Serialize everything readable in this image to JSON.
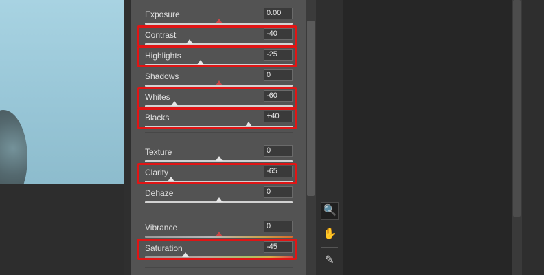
{
  "sliders": [
    {
      "id": "exposure",
      "label": "Exposure",
      "value": "0.00",
      "pos": 0.5,
      "neutral": true,
      "highlighted": false,
      "track": "plain"
    },
    {
      "id": "contrast",
      "label": "Contrast",
      "value": "-40",
      "pos": 0.3,
      "neutral": false,
      "highlighted": true,
      "track": "plain"
    },
    {
      "id": "highlights",
      "label": "Highlights",
      "value": "-25",
      "pos": 0.375,
      "neutral": false,
      "highlighted": true,
      "track": "plain"
    },
    {
      "id": "shadows",
      "label": "Shadows",
      "value": "0",
      "pos": 0.5,
      "neutral": true,
      "highlighted": false,
      "track": "plain"
    },
    {
      "id": "whites",
      "label": "Whites",
      "value": "-60",
      "pos": 0.2,
      "neutral": false,
      "highlighted": true,
      "track": "plain"
    },
    {
      "id": "blacks",
      "label": "Blacks",
      "value": "+40",
      "pos": 0.7,
      "neutral": false,
      "highlighted": true,
      "track": "plain"
    },
    {
      "id": "texture",
      "label": "Texture",
      "value": "0",
      "pos": 0.5,
      "neutral": false,
      "highlighted": false,
      "track": "plain"
    },
    {
      "id": "clarity",
      "label": "Clarity",
      "value": "-65",
      "pos": 0.175,
      "neutral": false,
      "highlighted": true,
      "track": "plain"
    },
    {
      "id": "dehaze",
      "label": "Dehaze",
      "value": "0",
      "pos": 0.5,
      "neutral": false,
      "highlighted": false,
      "track": "plain"
    },
    {
      "id": "vibrance",
      "label": "Vibrance",
      "value": "0",
      "pos": 0.5,
      "neutral": true,
      "highlighted": false,
      "track": "vib"
    },
    {
      "id": "saturation",
      "label": "Saturation",
      "value": "-45",
      "pos": 0.275,
      "neutral": false,
      "highlighted": true,
      "track": "sat"
    }
  ],
  "tools": [
    {
      "name": "zoom-tool-icon",
      "glyph": "🔍",
      "active": true
    },
    {
      "name": "hand-tool-icon",
      "glyph": "✋",
      "active": false
    },
    {
      "name": "eyedropper-tool-icon",
      "glyph": "✎",
      "active": false
    }
  ],
  "colors": {
    "highlight": "#e01515",
    "panel": "#535353",
    "thumb_neutral": "#c94747"
  }
}
